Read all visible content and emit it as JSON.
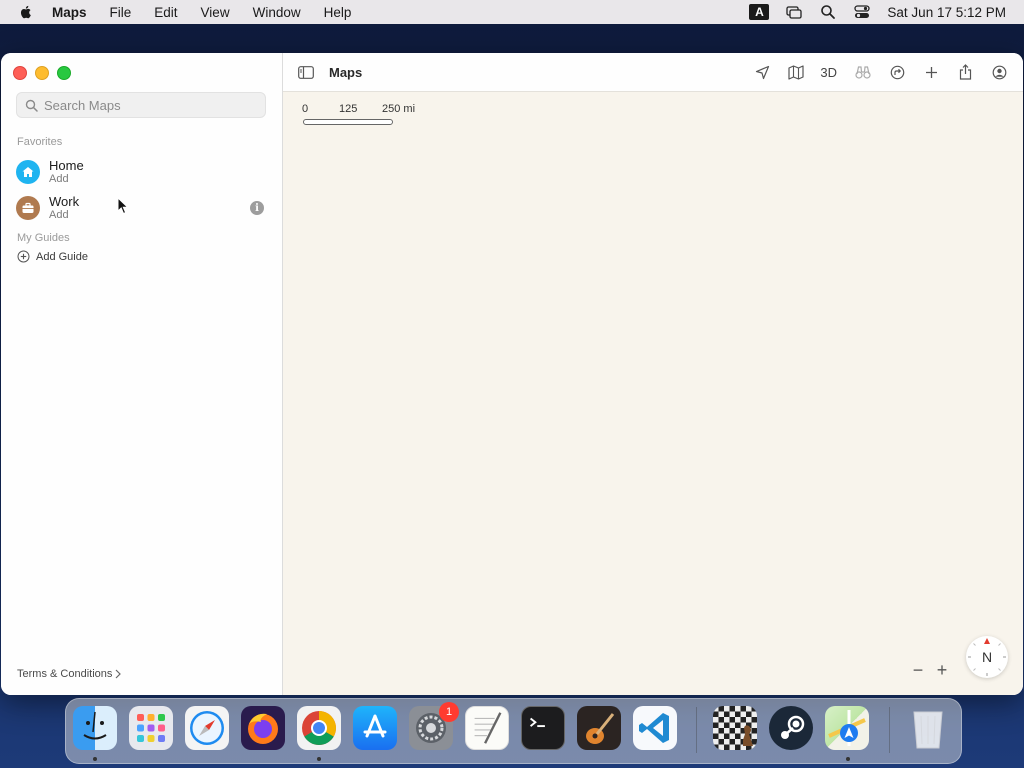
{
  "menubar": {
    "app_name": "Maps",
    "items": [
      "File",
      "Edit",
      "View",
      "Window",
      "Help"
    ],
    "input_source": "A",
    "datetime": "Sat Jun 17  5:12 PM"
  },
  "sidebar": {
    "search_placeholder": "Search Maps",
    "favorites_header": "Favorites",
    "favorites": [
      {
        "title": "Home",
        "subtitle": "Add",
        "icon": "house-icon",
        "color": "#1fb4f0"
      },
      {
        "title": "Work",
        "subtitle": "Add",
        "icon": "briefcase-icon",
        "color": "#b07a4f"
      }
    ],
    "guides_header": "My Guides",
    "add_guide_label": "Add Guide",
    "terms_label": "Terms & Conditions"
  },
  "toolbar": {
    "title": "Maps",
    "three_d_label": "3D"
  },
  "map": {
    "scale_labels": [
      "0",
      "125",
      "250 mi"
    ],
    "compass_label": "N",
    "zoom_out_label": "−",
    "zoom_in_label": "+"
  },
  "dock": {
    "apps": [
      "Finder",
      "Launchpad",
      "Safari",
      "Firefox",
      "Chrome",
      "App Store",
      "System Preferences",
      "TextEdit",
      "Terminal",
      "GarageBand",
      "Visual Studio Code",
      "Chess",
      "Steam",
      "Maps",
      "Trash"
    ],
    "system_prefs_badge": "1"
  }
}
